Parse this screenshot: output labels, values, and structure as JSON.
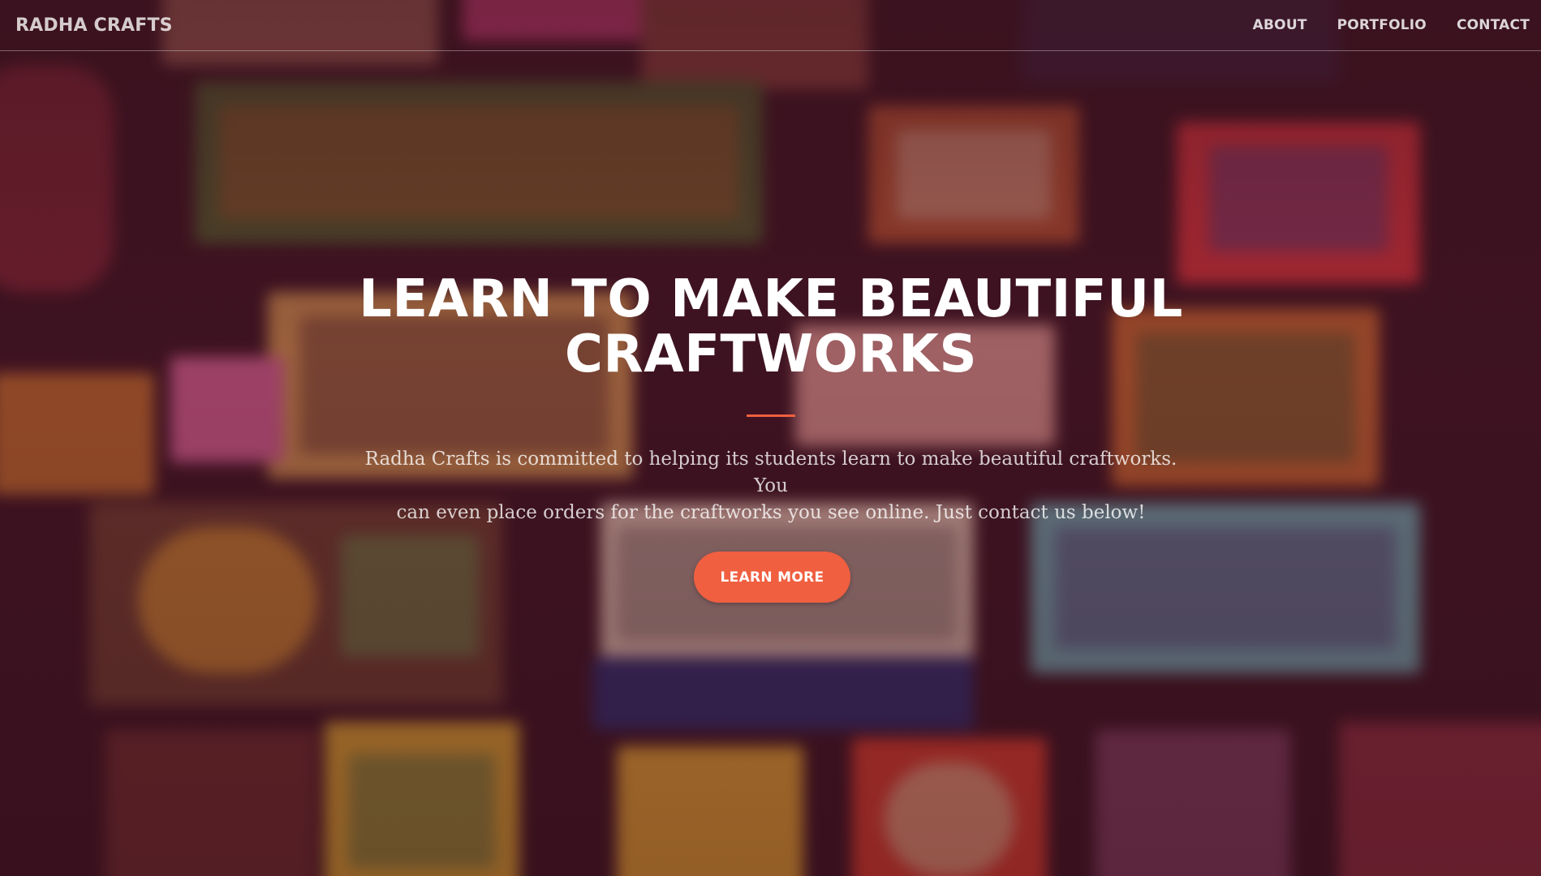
{
  "navbar": {
    "brand": "RADHA CRAFTS",
    "links": [
      {
        "label": "ABOUT"
      },
      {
        "label": "PORTFOLIO"
      },
      {
        "label": "CONTACT"
      }
    ]
  },
  "hero": {
    "title_line1": "LEARN TO MAKE BEAUTIFUL",
    "title_line2": "CRAFTWORKS",
    "description_line1": "Radha Crafts is committed to helping its students learn to make beautiful craftworks. You",
    "description_line2": "can even place orders for the craftworks you see online. Just contact us below!",
    "button_label": "LEARN MORE"
  },
  "colors": {
    "accent": "#f05f40",
    "heading": "#ffffff",
    "background_tint": "#3a1220"
  }
}
